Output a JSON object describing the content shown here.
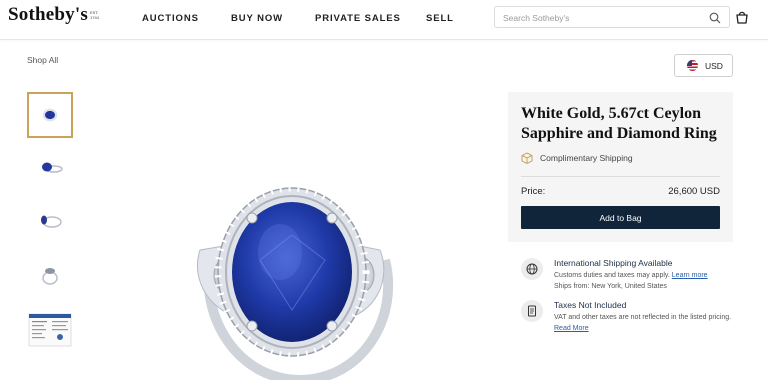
{
  "header": {
    "logo": "Sotheby's",
    "logo_est": "EST. 1744",
    "nav": [
      "AUCTIONS",
      "BUY NOW",
      "PRIVATE SALES",
      "SELL"
    ],
    "search_placeholder": "Search Sotheby's",
    "icons": {
      "search": "search-icon",
      "bag": "shopping-bag-icon"
    }
  },
  "breadcrumb": "Shop All",
  "currency": {
    "label": "USD",
    "flag": "us-flag-icon"
  },
  "gallery": {
    "thumbnails": [
      {
        "name": "ring-top-view",
        "active": true
      },
      {
        "name": "ring-angled-view",
        "active": false
      },
      {
        "name": "ring-side-view",
        "active": false
      },
      {
        "name": "ring-profile-view",
        "active": false
      },
      {
        "name": "certificate-document",
        "active": false
      }
    ]
  },
  "product": {
    "title": "White Gold, 5.67ct Ceylon Sapphire and Diamond Ring",
    "shipping_note": "Complimentary Shipping",
    "price_label": "Price:",
    "price_value": "26,600 USD",
    "add_to_bag": "Add to Bag"
  },
  "info": [
    {
      "icon": "globe-icon",
      "title": "International Shipping Available",
      "line1": "Customs duties and taxes may apply.",
      "link": "Learn more",
      "line2": "Ships from: New York, United States"
    },
    {
      "icon": "receipt-icon",
      "title": "Taxes Not Included",
      "line1": "VAT and other taxes are not reflected in the listed pricing.",
      "link": "Read More"
    }
  ],
  "colors": {
    "brand_navy": "#10243a",
    "panel_bg": "#f5f5f5",
    "thumb_active_border": "#c9a458",
    "link": "#2a5dab",
    "sapphire": "#1f3aa8"
  }
}
